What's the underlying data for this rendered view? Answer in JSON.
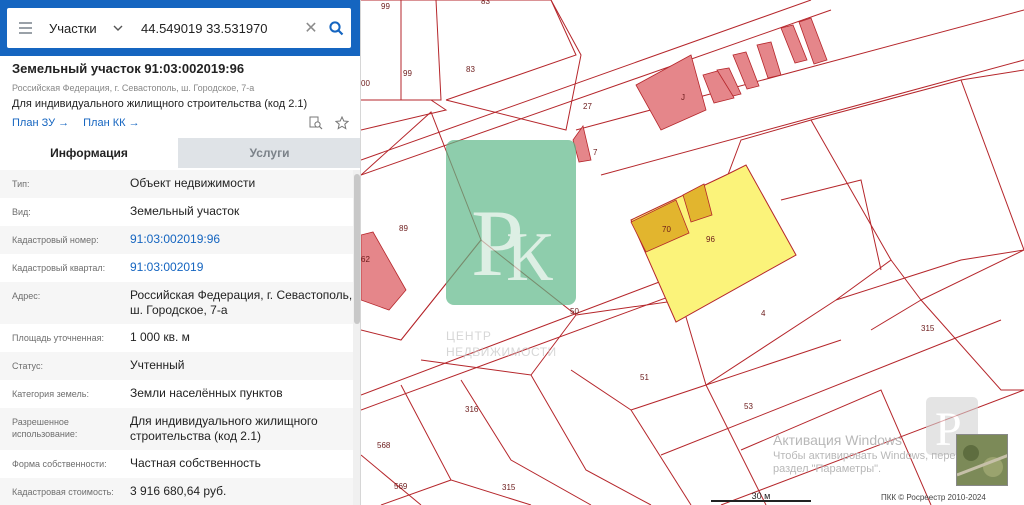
{
  "search": {
    "layer": "Участки",
    "query": "44.549019 33.531970"
  },
  "object": {
    "title": "Земельный участок 91:03:002019:96",
    "address_line": "Российская Федерация, г. Севастополь, ш. Городское, 7-а",
    "use": "Для индивидуального жилищного строительства (код 2.1)",
    "plan_zu": "План ЗУ →",
    "plan_kk": "План КК →"
  },
  "tabs": {
    "info": "Информация",
    "services": "Услуги"
  },
  "properties": [
    {
      "label": "Тип:",
      "value": "Объект недвижимости",
      "link": false
    },
    {
      "label": "Вид:",
      "value": "Земельный участок",
      "link": false
    },
    {
      "label": "Кадастровый номер:",
      "value": "91:03:002019:96",
      "link": true
    },
    {
      "label": "Кадастровый квартал:",
      "value": "91:03:002019",
      "link": true
    },
    {
      "label": "Адрес:",
      "value": "Российская Федерация, г. Севастополь, ш. Городское, 7-а",
      "link": false
    },
    {
      "label": "Площадь уточненная:",
      "value": "1 000 кв. м",
      "link": false
    },
    {
      "label": "Статус:",
      "value": "Учтенный",
      "link": false
    },
    {
      "label": "Категория земель:",
      "value": "Земли населённых пунктов",
      "link": false
    },
    {
      "label": "Разрешенное использование:",
      "value": "Для индивидуального жилищного строительства (код 2.1)",
      "link": false
    },
    {
      "label": "Форма собственности:",
      "value": "Частная собственность",
      "link": false
    },
    {
      "label": "Кадастровая стоимость:",
      "value": "3 916 680,64 руб.",
      "link": false
    }
  ],
  "map": {
    "parcel_labels": {
      "p99a": "99",
      "p99b": "99",
      "p83a": "83",
      "p83b": "83",
      "p00": "00",
      "p27": "27",
      "p7": "7",
      "pJ": "J",
      "p89": "89",
      "p62": "62",
      "p70": "70",
      "p96": "96",
      "p50": "50",
      "p4": "4",
      "p315a": "315",
      "p51": "51",
      "p316": "316",
      "p53": "53",
      "p568": "568",
      "p569": "569",
      "p315b": "315"
    },
    "watermark_text_1": "ЦЕНТР",
    "watermark_text_2": "НЕДВИЖИМОСТИ",
    "scale_label": "30 м",
    "copyright": "ПКК © Росреестр 2010-2024",
    "windows_title": "Активация Windows",
    "windows_sub_1": "Чтобы активировать Windows, перейдите в",
    "windows_sub_2": "раздел \"Параметры\"."
  },
  "colors": {
    "header_blue": "#1565c0",
    "parcel_line": "#b5262b",
    "selected_parcel": "#fbf37a",
    "building": "#e5868a",
    "watermark_green": "#5fb88a"
  },
  "icons": {
    "menu": "menu-icon",
    "chevron": "chevron-down-icon",
    "clear": "close-icon",
    "search": "search-icon",
    "collapse": "chevron-left-icon",
    "doc_search": "document-search-icon",
    "favorite": "star-icon"
  }
}
